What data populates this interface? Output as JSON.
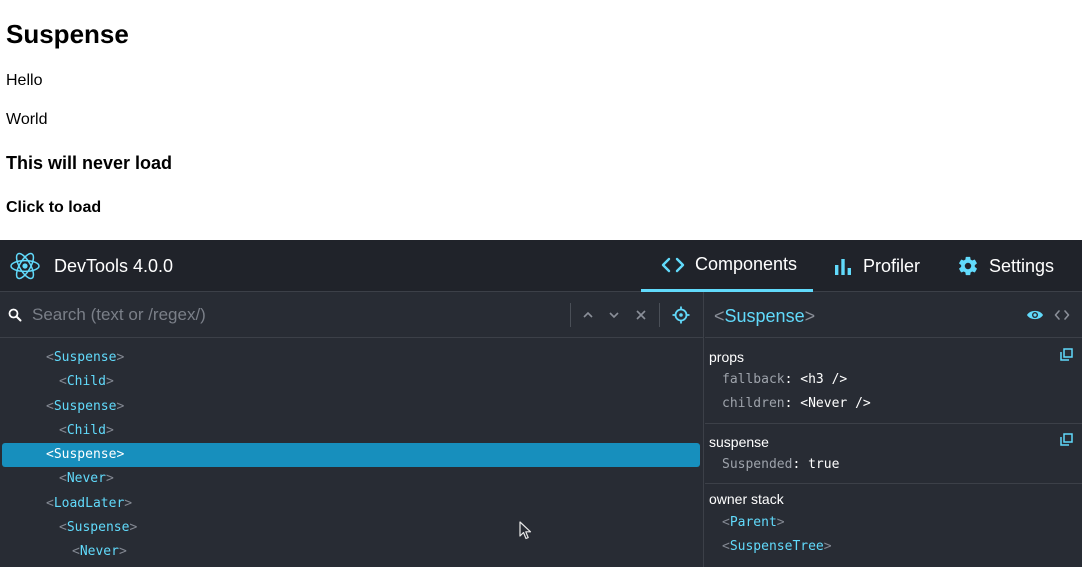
{
  "page": {
    "title": "Suspense",
    "paragraphs": [
      "Hello",
      "World"
    ],
    "heading3": "This will never load",
    "button_label": "Click to load"
  },
  "devtools": {
    "title": "DevTools 4.0.0",
    "tabs": [
      {
        "label": "Components",
        "icon": "code-icon",
        "active": true
      },
      {
        "label": "Profiler",
        "icon": "bar-chart-icon",
        "active": false
      },
      {
        "label": "Settings",
        "icon": "gear-icon",
        "active": false
      }
    ],
    "search": {
      "placeholder": "Search (text or /regex/)",
      "value": ""
    },
    "tree": [
      {
        "name": "Suspense",
        "depth": 1,
        "selected": false
      },
      {
        "name": "Child",
        "depth": 2,
        "selected": false
      },
      {
        "name": "Suspense",
        "depth": 1,
        "selected": false
      },
      {
        "name": "Child",
        "depth": 2,
        "selected": false
      },
      {
        "name": "Suspense",
        "depth": 1,
        "selected": true
      },
      {
        "name": "Never",
        "depth": 2,
        "selected": false
      },
      {
        "name": "LoadLater",
        "depth": 1,
        "selected": false
      },
      {
        "name": "Suspense",
        "depth": 2,
        "selected": false
      },
      {
        "name": "Never",
        "depth": 3,
        "selected": false
      }
    ],
    "inspector": {
      "selected_name": "Suspense",
      "props_title": "props",
      "props": [
        {
          "key": "fallback",
          "value": "<h3 />"
        },
        {
          "key": "children",
          "value": "<Never />"
        }
      ],
      "suspense_title": "suspense",
      "suspense_props": [
        {
          "key": "Suspended",
          "value": "true"
        }
      ],
      "owner_stack_title": "owner stack",
      "owners": [
        "Parent",
        "SuspenseTree"
      ]
    }
  },
  "colors": {
    "accent": "#61dafb",
    "selected_row": "#178fbd",
    "panel_bg": "#282c34",
    "topbar_bg": "#20232a"
  }
}
